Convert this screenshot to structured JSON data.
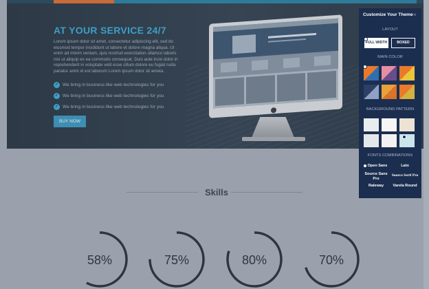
{
  "hero": {
    "title": "AT YOUR SERVICE 24/7",
    "paragraph": "Lorem ipsum dolor sit amet, consectetur adipiscing elit, sed do eiusmod tempor incididunt ut labore et dolore magna aliqua. Ut enim ad minim veniam, quis nostrud exercitation ullamco laboris nisi ut aliquip ex ea commodo consequat. Duis aute irure dolor in reprehenderit in voluptate velit esse cillum dolore eu fugiat nulla pariatur anim id est laborum Lorem ipsum dolor sit ameta.",
    "features": [
      "We bring in business like web technologies for you",
      "We bring in business like web technologies for you",
      "We bring in business like web technologies for you"
    ],
    "button": "BUY NOW",
    "check_glyph": "✓"
  },
  "skills": {
    "title": "Skills",
    "items": [
      {
        "label": "58%",
        "percent": 58
      },
      {
        "label": "75%",
        "percent": 75
      },
      {
        "label": "80%",
        "percent": 80
      },
      {
        "label": "70%",
        "percent": 70
      }
    ]
  },
  "customizer": {
    "title": "Customize Your Theme",
    "close": "×",
    "layout_label": "LAYOUT",
    "layout_options": [
      "FULL WIDTH",
      "BOXED"
    ],
    "main_color_label": "MAIN COLOR",
    "main_colors": [
      [
        "#e9792b",
        "#2f6fb0"
      ],
      [
        "#e58fa3",
        "#6a4c8c"
      ],
      [
        "#e9792b",
        "#e9c63a"
      ],
      [
        "#2e3f66",
        "#8fa1c4"
      ],
      [
        "#e7a23a",
        "#d9722b"
      ],
      [
        "#e9792b",
        "#d4b13e"
      ]
    ],
    "background_pattern_label": "BACKGROUND PATTERN",
    "fonts_label": "FONTS COMBINATIONS",
    "fonts": [
      "Open Sans",
      "Lato",
      "Source Sans Pro",
      "Source Serif Pro",
      "Raleway",
      "Varela Round"
    ]
  },
  "colors": {
    "accent": "#3d9fc4",
    "panel": "#1c2e4f",
    "ring": "#2d3640"
  }
}
